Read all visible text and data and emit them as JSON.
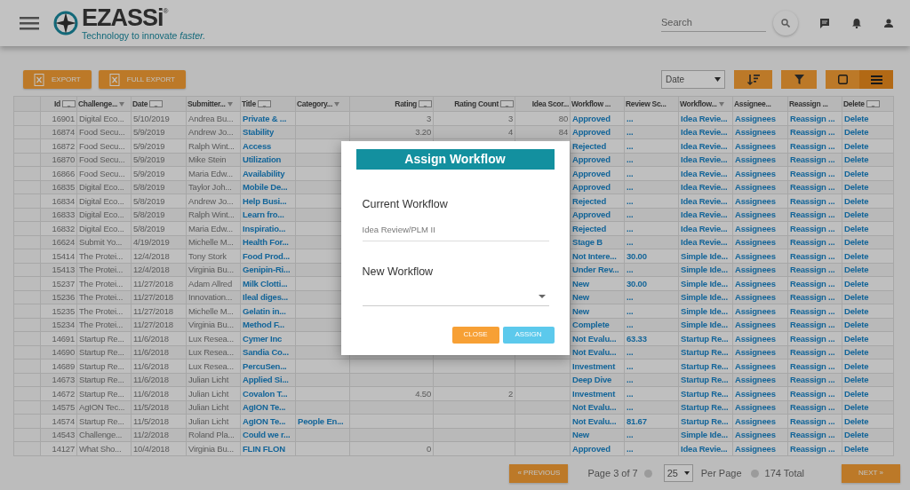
{
  "navbar": {
    "logo_text": "EZASSi",
    "logo_mark": "®",
    "tagline": "Technology to innovate *faster.*",
    "search": {
      "placeholder": "Search"
    }
  },
  "toolbar": {
    "export_buttons": [
      "EXPORT",
      "FULL EXPORT"
    ],
    "sort_field": "Date",
    "view_buttons": [
      {
        "kind": "grid",
        "selected": false
      },
      {
        "kind": "list",
        "selected": true
      }
    ]
  },
  "table": {
    "columns": [
      {
        "label": "Id",
        "kind": "number",
        "menu_button": true
      },
      {
        "label": "Challenge...",
        "kind": "text",
        "filter": true
      },
      {
        "label": "Date",
        "kind": "text",
        "menu_button": true
      },
      {
        "label": "Submitter...",
        "kind": "text",
        "filter": true
      },
      {
        "label": "Title",
        "kind": "link",
        "menu_button": true
      },
      {
        "label": "Category...",
        "kind": "link",
        "filter": true
      },
      {
        "label": "Rating",
        "kind": "number",
        "menu_button": true
      },
      {
        "label": "Rating Count",
        "kind": "number",
        "menu_button": true
      },
      {
        "label": "Idea Scor...",
        "kind": "number"
      },
      {
        "label": "Workflow ...",
        "kind": "link"
      },
      {
        "label": "Review Sc...",
        "kind": "link"
      },
      {
        "label": "Workflow...",
        "kind": "link",
        "filter": true
      },
      {
        "label": "Assignee...",
        "kind": "link"
      },
      {
        "label": "Reassign ...",
        "kind": "link"
      },
      {
        "label": "Delete",
        "kind": "link",
        "menu_button": true
      }
    ],
    "rows": [
      [
        "16901",
        "Digital Eco...",
        "5/10/2019",
        "Andrea Bu...",
        "Private & ...",
        null,
        "3",
        "3",
        "80",
        "Approved",
        "...",
        "Idea Revie...",
        "Assignees",
        "Reassign ...",
        "Delete"
      ],
      [
        "16874",
        "Food Secu...",
        "5/9/2019",
        "Andrew Jo...",
        "Stability",
        null,
        "3.20",
        "4",
        "84",
        "Approved",
        "...",
        "Idea Revie...",
        "Assignees",
        "Reassign ...",
        "Delete"
      ],
      [
        "16872",
        "Food Secu...",
        "5/9/2019",
        "Ralph Wint...",
        "Access",
        null,
        null,
        null,
        null,
        "Rejected",
        "...",
        "Idea Revie...",
        "Assignees",
        "Reassign ...",
        "Delete"
      ],
      [
        "16870",
        "Food Secu...",
        "5/9/2019",
        "Mike Stein",
        "Utilization",
        null,
        null,
        null,
        null,
        "Approved",
        "...",
        "Idea Revie...",
        "Assignees",
        "Reassign ...",
        "Delete"
      ],
      [
        "16866",
        "Food Secu...",
        "5/9/2019",
        "Maria Edw...",
        "Availability",
        null,
        null,
        null,
        null,
        "Approved",
        "...",
        "Idea Revie...",
        "Assignees",
        "Reassign ...",
        "Delete"
      ],
      [
        "16835",
        "Digital Eco...",
        "5/8/2019",
        "Taylor Joh...",
        "Mobile De...",
        null,
        null,
        null,
        null,
        "Approved",
        "...",
        "Idea Revie...",
        "Assignees",
        "Reassign ...",
        "Delete"
      ],
      [
        "16834",
        "Digital Eco...",
        "5/8/2019",
        "Andrew Jo...",
        "Help Busi...",
        null,
        null,
        null,
        null,
        "Rejected",
        "...",
        "Idea Revie...",
        "Assignees",
        "Reassign ...",
        "Delete"
      ],
      [
        "16833",
        "Digital Eco...",
        "5/8/2019",
        "Ralph Wint...",
        "Learn fro...",
        null,
        null,
        null,
        null,
        "Approved",
        "...",
        "Idea Revie...",
        "Assignees",
        "Reassign ...",
        "Delete"
      ],
      [
        "16832",
        "Digital Eco...",
        "5/8/2019",
        "Maria Edw...",
        "Inspiratio...",
        null,
        null,
        null,
        null,
        "Rejected",
        "...",
        "Idea Revie...",
        "Assignees",
        "Reassign ...",
        "Delete"
      ],
      [
        "16624",
        "Submit Yo...",
        "4/19/2019",
        "Michelle M...",
        "Health For...",
        null,
        null,
        null,
        null,
        "Stage B",
        "...",
        "Idea Revie...",
        "Assignees",
        "Reassign ...",
        "Delete"
      ],
      [
        "15414",
        "The Protei...",
        "12/4/2018",
        "Tony Stork",
        "Food Prod...",
        null,
        null,
        null,
        null,
        "Not Intere...",
        "30.00",
        "Simple Ide...",
        "Assignees",
        "Reassign ...",
        "Delete"
      ],
      [
        "15413",
        "The Protei...",
        "12/4/2018",
        "Virginia Bu...",
        "Genipin-Ri...",
        null,
        null,
        null,
        null,
        "Under Rev...",
        "...",
        "Simple Ide...",
        "Assignees",
        "Reassign ...",
        "Delete"
      ],
      [
        "15237",
        "The Protei...",
        "11/27/2018",
        "Adam Allred",
        "Milk Clotti...",
        null,
        null,
        null,
        null,
        "New",
        "30.00",
        "Simple Ide...",
        "Assignees",
        "Reassign ...",
        "Delete"
      ],
      [
        "15236",
        "The Protei...",
        "11/27/2018",
        "Innovation...",
        "Ileal diges...",
        null,
        null,
        null,
        null,
        "New",
        "...",
        "Simple Ide...",
        "Assignees",
        "Reassign ...",
        "Delete"
      ],
      [
        "15235",
        "The Protei...",
        "11/27/2018",
        "Michelle M...",
        "Gelatin in...",
        null,
        null,
        null,
        null,
        "New",
        "...",
        "Simple Ide...",
        "Assignees",
        "Reassign ...",
        "Delete"
      ],
      [
        "15234",
        "The Protei...",
        "11/27/2018",
        "Virginia Bu...",
        "Method F...",
        null,
        null,
        null,
        null,
        "Complete",
        "...",
        "Simple Ide...",
        "Assignees",
        "Reassign ...",
        "Delete"
      ],
      [
        "14691",
        "Startup Re...",
        "11/6/2018",
        "Lux Resea...",
        "Cymer Inc",
        null,
        null,
        null,
        null,
        "Not Evalu...",
        "63.33",
        "Startup Re...",
        "Assignees",
        "Reassign ...",
        "Delete"
      ],
      [
        "14690",
        "Startup Re...",
        "11/6/2018",
        "Lux Resea...",
        "Sandia Co...",
        null,
        null,
        null,
        null,
        "Not Evalu...",
        "...",
        "Startup Re...",
        "Assignees",
        "Reassign ...",
        "Delete"
      ],
      [
        "14689",
        "Startup Re...",
        "11/6/2018",
        "Lux Resea...",
        "PercuSen...",
        null,
        null,
        null,
        null,
        "Investment",
        "...",
        "Startup Re...",
        "Assignees",
        "Reassign ...",
        "Delete"
      ],
      [
        "14673",
        "Startup Re...",
        "11/6/2018",
        "Julian Licht",
        "Applied Si...",
        null,
        null,
        null,
        null,
        "Deep Dive",
        "...",
        "Startup Re...",
        "Assignees",
        "Reassign ...",
        "Delete"
      ],
      [
        "14672",
        "Startup Re...",
        "11/6/2018",
        "Julian Licht",
        "Covalon T...",
        null,
        "4.50",
        "2",
        null,
        "Investment",
        "...",
        "Startup Re...",
        "Assignees",
        "Reassign ...",
        "Delete"
      ],
      [
        "14575",
        "AgION Tec...",
        "11/5/2018",
        "Julian Licht",
        "AgION Te...",
        null,
        null,
        null,
        null,
        "Not Evalu...",
        "...",
        "Startup Re...",
        "Assignees",
        "Reassign ...",
        "Delete"
      ],
      [
        "14574",
        "Startup Re...",
        "11/5/2018",
        "Julian Licht",
        "AgION Te...",
        "People En...",
        null,
        null,
        null,
        "Not Evalu...",
        "81.67",
        "Startup Re...",
        "Assignees",
        "Reassign ...",
        "Delete"
      ],
      [
        "14543",
        "Challenge...",
        "11/2/2018",
        "Roland Pla...",
        "Could we r...",
        null,
        null,
        null,
        null,
        "New",
        "...",
        "Simple Ide...",
        "Assignees",
        "Reassign ...",
        "Delete"
      ],
      [
        "14127",
        "What Sho...",
        "10/4/2018",
        "Virginia Bu...",
        "FLIN FLON",
        null,
        "0",
        null,
        null,
        "Approved",
        "...",
        "Idea Revie...",
        "Assignees",
        "Reassign ...",
        "Delete"
      ]
    ]
  },
  "pagination": {
    "previous": "« PREVIOUS",
    "page_info": "Page 3 of 7",
    "per_page_value": "25",
    "per_page_label": "Per Page",
    "total": "174 Total",
    "next": "NEXT »"
  },
  "modal": {
    "title": "Assign Workflow",
    "current_label": "Current Workflow",
    "current_value": "Idea Review/PLM II",
    "new_label": "New Workflow",
    "buttons": [
      {
        "label": "CLOSE",
        "kind": "close"
      },
      {
        "label": "ASSIGN",
        "kind": "assign"
      }
    ]
  }
}
